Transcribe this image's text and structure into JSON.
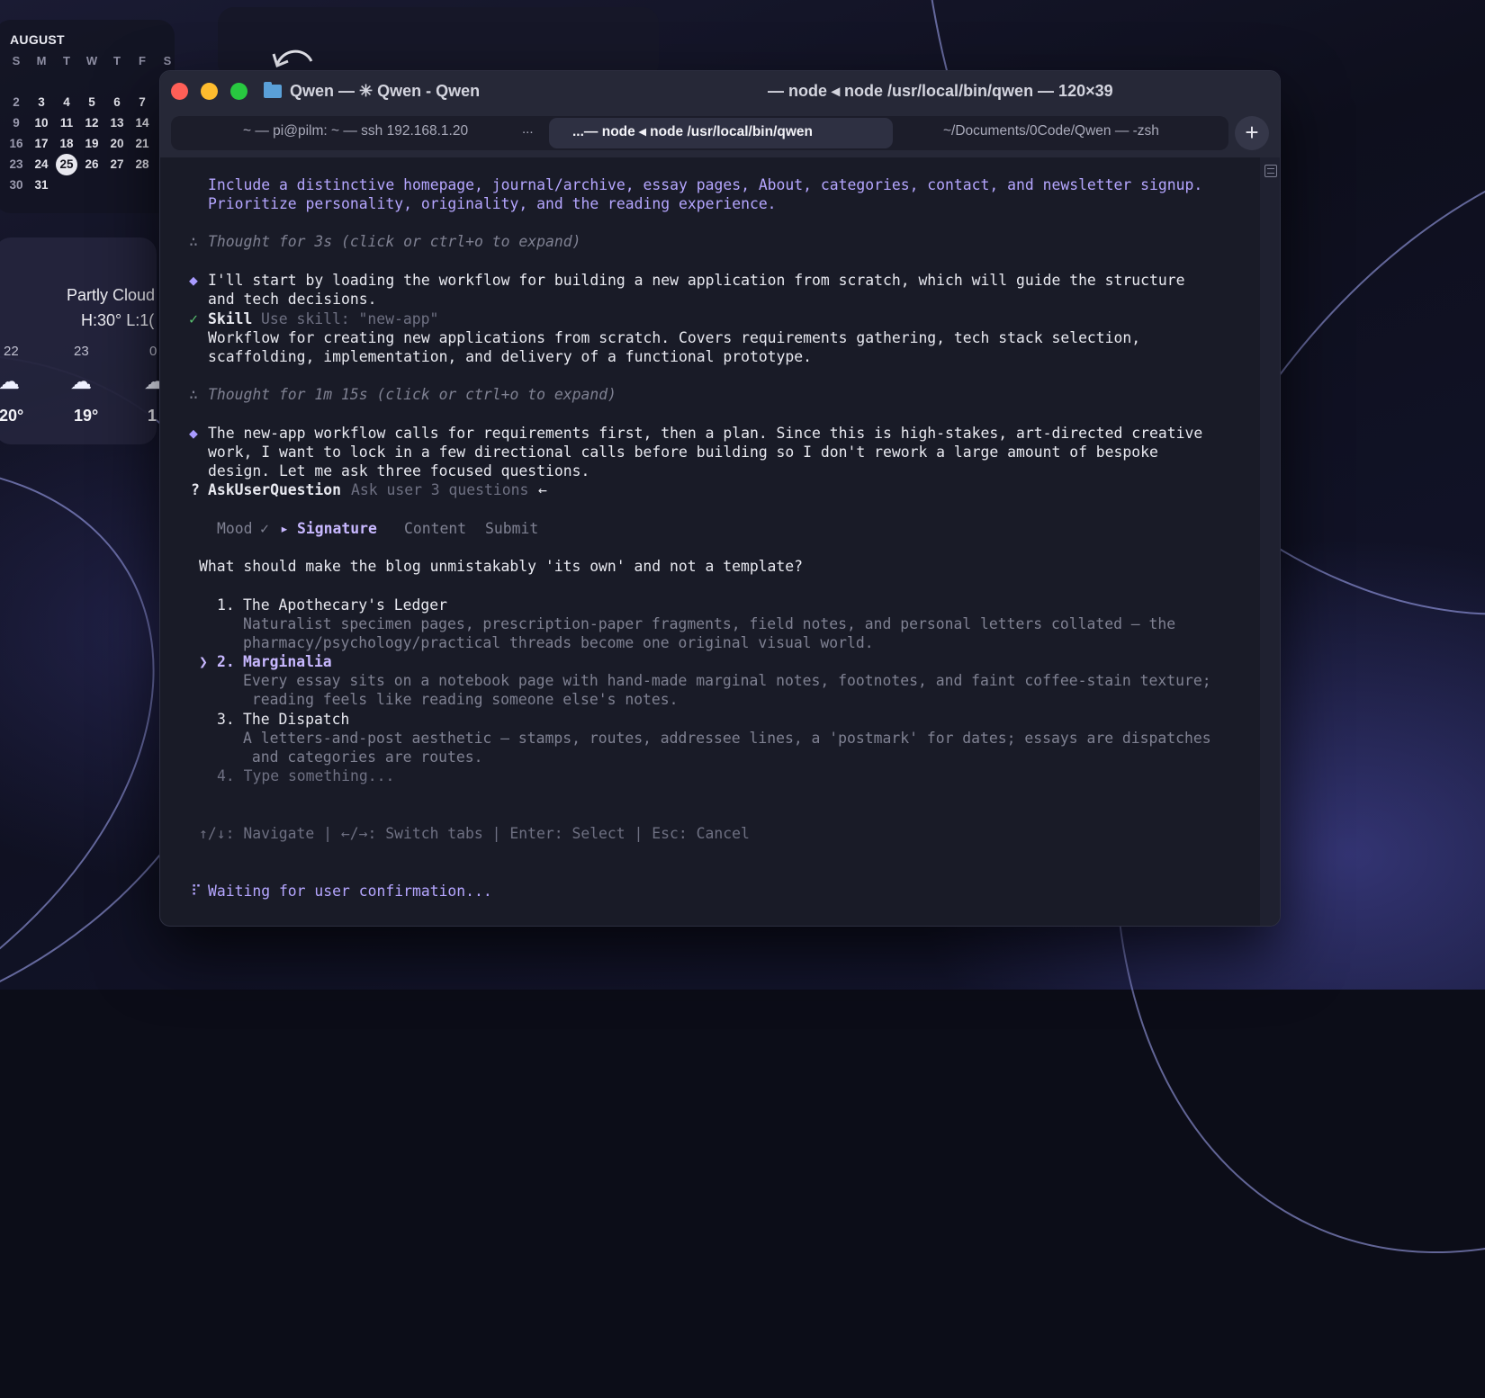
{
  "calendar": {
    "month": "AUGUST",
    "weekdays": [
      "S",
      "M",
      "T",
      "W",
      "T",
      "F",
      "S"
    ],
    "rows": [
      [
        "2",
        "3",
        "4",
        "5",
        "6",
        "7"
      ],
      [
        "9",
        "10",
        "11",
        "12",
        "13",
        "14"
      ],
      [
        "16",
        "17",
        "18",
        "19",
        "20",
        "21"
      ],
      [
        "23",
        "24",
        "25",
        "26",
        "27",
        "28"
      ],
      [
        "30",
        "31"
      ]
    ],
    "today": "25"
  },
  "weather": {
    "condition": "Partly Cloud",
    "hilo": "H:30° L:1(",
    "hours": [
      "22",
      "23",
      "0"
    ],
    "temps": [
      "20°",
      "19°",
      "1"
    ]
  },
  "window": {
    "title_left": "Qwen — ✳ Qwen - Qwen",
    "title_right": "— node ◂ node /usr/local/bin/qwen — 120×39",
    "tabs": [
      "~ — pi@pilm: ~ — ssh 192.168.1.20",
      "...— node ◂ node /usr/local/bin/qwen",
      "~/Documents/0Code/Qwen — -zsh"
    ],
    "tab_more": "...",
    "new_tab": "+"
  },
  "terminal": {
    "prompt_lines": [
      "Include a distinctive homepage, journal/archive, essay pages, About, categories, contact, and newsletter signup.",
      "Prioritize personality, originality, and the reading experience."
    ],
    "thought1": "Thought for 3s (click or ctrl+o to expand)",
    "msg1": [
      "I'll start by loading the workflow for building a new application from scratch, which will guide the structure",
      "and tech decisions."
    ],
    "skill_label": "Skill",
    "skill_desc": "Use skill: \"new-app\"",
    "skill_text": [
      "Workflow for creating new applications from scratch. Covers requirements gathering, tech stack selection,",
      "scaffolding, implementation, and delivery of a functional prototype."
    ],
    "thought2": "Thought for 1m 15s (click or ctrl+o to expand)",
    "msg2": [
      "The new-app workflow calls for requirements first, then a plan. Since this is high-stakes, art-directed creative",
      "work, I want to lock in a few directional calls before building so I don't rework a large amount of bespoke",
      "design. Let me ask three focused questions."
    ],
    "ask_label": "AskUserQuestion",
    "ask_desc": "Ask user 3 questions",
    "steps": {
      "mood": "Mood",
      "signature": "Signature",
      "content": "Content",
      "submit": "Submit"
    },
    "question": "What should make the blog unmistakably 'its own' and not a template?",
    "options": [
      {
        "num": "1.",
        "title": "The Apothecary's Ledger",
        "desc": [
          "Naturalist specimen pages, prescription-paper fragments, field notes, and personal letters collated — the",
          "pharmacy/psychology/practical threads become one original visual world."
        ]
      },
      {
        "num": "2.",
        "title": "Marginalia",
        "desc": [
          "Every essay sits on a notebook page with hand-made marginal notes, footnotes, and faint coffee-stain texture;",
          " reading feels like reading someone else's notes."
        ]
      },
      {
        "num": "3.",
        "title": "The Dispatch",
        "desc": [
          "A letters-and-post aesthetic — stamps, routes, addressee lines, a 'postmark' for dates; essays are dispatches",
          " and categories are routes."
        ]
      }
    ],
    "type_option": "4. Type something...",
    "help": "↑/↓: Navigate | ←/→: Switch tabs | Enter: Select | Esc: Cancel",
    "status": "Waiting for user confirmation..."
  }
}
